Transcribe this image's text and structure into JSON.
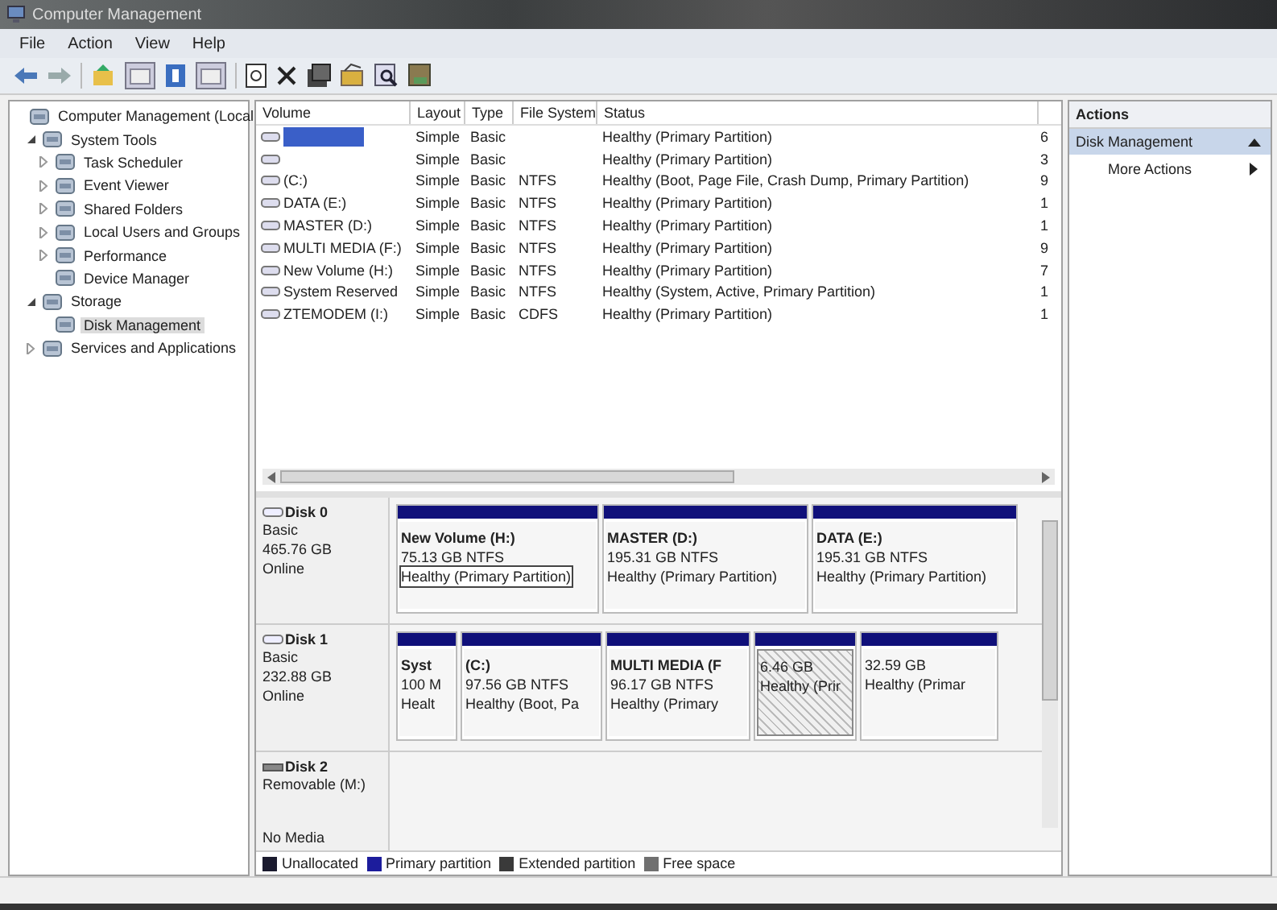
{
  "window": {
    "title": "Computer Management"
  },
  "menu": [
    "File",
    "Action",
    "View",
    "Help"
  ],
  "tree": [
    {
      "label": "Computer Management (Local",
      "selected": false,
      "children": [
        {
          "label": "System Tools",
          "expanded": true,
          "selected": false,
          "children": [
            {
              "label": "Task Scheduler",
              "expanded": false,
              "selected": false
            },
            {
              "label": "Event Viewer",
              "expanded": false,
              "selected": false
            },
            {
              "label": "Shared Folders",
              "expanded": false,
              "selected": false
            },
            {
              "label": "Local Users and Groups",
              "expanded": false,
              "selected": false
            },
            {
              "label": "Performance",
              "expanded": false,
              "selected": false
            },
            {
              "label": "Device Manager",
              "selected": false
            }
          ]
        },
        {
          "label": "Storage",
          "expanded": true,
          "selected": false,
          "children": [
            {
              "label": "Disk Management",
              "selected": true
            }
          ]
        },
        {
          "label": "Services and Applications",
          "expanded": false,
          "selected": false
        }
      ]
    }
  ],
  "table": {
    "columns": [
      "Volume",
      "Layout",
      "Type",
      "File System",
      "Status"
    ],
    "rows": [
      {
        "selected": true,
        "layout": "Simple",
        "type": "Basic",
        "status": "Healthy (Primary Partition)",
        "column_6": "6"
      },
      {
        "selected": false,
        "layout": "Simple",
        "type": "Basic",
        "status": "Healthy (Primary Partition)",
        "column_6": "3"
      },
      {
        "selected": false,
        "volume": "(C:)",
        "layout": "Simple",
        "type": "Basic",
        "file_system": "NTFS",
        "status": "Healthy (Boot, Page File, Crash Dump, Primary Partition)",
        "column_6": "9"
      },
      {
        "selected": false,
        "volume": "DATA (E:)",
        "layout": "Simple",
        "type": "Basic",
        "file_system": "NTFS",
        "status": "Healthy (Primary Partition)",
        "column_6": "1"
      },
      {
        "selected": false,
        "volume": "MASTER (D:)",
        "layout": "Simple",
        "type": "Basic",
        "file_system": "NTFS",
        "status": "Healthy (Primary Partition)",
        "column_6": "1"
      },
      {
        "selected": false,
        "volume": "MULTI MEDIA (F:)",
        "layout": "Simple",
        "type": "Basic",
        "file_system": "NTFS",
        "status": "Healthy (Primary Partition)",
        "column_6": "9"
      },
      {
        "selected": false,
        "volume": "New Volume (H:)",
        "layout": "Simple",
        "type": "Basic",
        "file_system": "NTFS",
        "status": "Healthy (Primary Partition)",
        "column_6": "7"
      },
      {
        "selected": false,
        "volume": "System Reserved",
        "layout": "Simple",
        "type": "Basic",
        "file_system": "NTFS",
        "status": "Healthy (System, Active, Primary Partition)",
        "column_6": "1"
      },
      {
        "selected": false,
        "volume": "ZTEMODEM (I:)",
        "layout": "Simple",
        "type": "Basic",
        "file_system": "CDFS",
        "status": "Healthy (Primary Partition)",
        "column_6": "1"
      }
    ]
  },
  "disks": [
    {
      "kind": "basic",
      "name": "Disk 0",
      "lines": [
        "Basic",
        "465.76 GB",
        "Online"
      ],
      "partitions": [
        {
          "title": "New Volume  (H:)",
          "size": "75.13 GB NTFS",
          "status": "Healthy (Primary Partition)",
          "focused": true,
          "selected": false
        },
        {
          "title": "MASTER  (D:)",
          "size": "195.31 GB NTFS",
          "status": "Healthy (Primary Partition)",
          "focused": false,
          "selected": false
        },
        {
          "title": "DATA  (E:)",
          "size": "195.31 GB NTFS",
          "status": "Healthy (Primary Partition)",
          "focused": false,
          "selected": false
        }
      ]
    },
    {
      "kind": "basic",
      "name": "Disk 1",
      "lines": [
        "Basic",
        "232.88 GB",
        "Online"
      ],
      "partitions": [
        {
          "title": "Syst",
          "size": "100 M",
          "status": "Healt",
          "focused": false,
          "selected": false
        },
        {
          "title": "(C:)",
          "size": "97.56 GB NTFS",
          "status": "Healthy (Boot, Pa",
          "focused": false,
          "selected": false
        },
        {
          "title": "MULTI MEDIA  (F",
          "size": "96.17 GB NTFS",
          "status": "Healthy (Primary",
          "focused": false,
          "selected": false
        },
        {
          "size": "6.46 GB",
          "status": "Healthy (Prir",
          "focused": false,
          "selected": true
        },
        {
          "size": "32.59 GB",
          "status": "Healthy (Primar",
          "focused": false,
          "selected": false
        }
      ]
    },
    {
      "kind": "removable",
      "name": "Disk 2",
      "lines": [
        "Removable (M:)",
        "No Media"
      ]
    }
  ],
  "legend": [
    {
      "label": "Unallocated",
      "color": "#1a1a2e"
    },
    {
      "label": "Primary partition",
      "color": "#1c1c9c"
    },
    {
      "label": "Extended partition",
      "color": "#3a3a3a"
    },
    {
      "label": "Free space",
      "color": "#707070"
    }
  ],
  "actions": {
    "title": "Actions",
    "section": {
      "label": "Disk Management",
      "expanded": true
    },
    "items": [
      "More Actions"
    ]
  }
}
